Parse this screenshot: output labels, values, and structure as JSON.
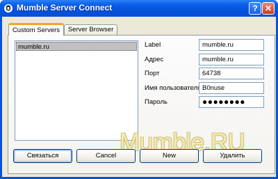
{
  "window": {
    "title": "Mumble Server Connect",
    "help_label": "?",
    "close_label": "✕"
  },
  "tabs": [
    {
      "label": "Custom Servers"
    },
    {
      "label": "Server Browser"
    }
  ],
  "server_list": [
    "mumble.ru"
  ],
  "form": {
    "label": {
      "label": "Label",
      "value": "mumble.ru"
    },
    "address": {
      "label": "Адрес",
      "value": "mumble.ru"
    },
    "port": {
      "label": "Порт",
      "value": "64738"
    },
    "username": {
      "label": "Имя пользователя",
      "value": "B0nuse"
    },
    "password": {
      "label": "Пароль",
      "value": "●●●●●●●●"
    }
  },
  "watermark": "Mumble.RU",
  "buttons": {
    "connect": "Связаться",
    "cancel": "Cancel",
    "new": "New",
    "delete": "Удалить"
  },
  "colors": {
    "titlebar": "#0a5ee6",
    "active_tab_accent": "#f7a32a",
    "dialog_bg": "#ece9d8"
  }
}
